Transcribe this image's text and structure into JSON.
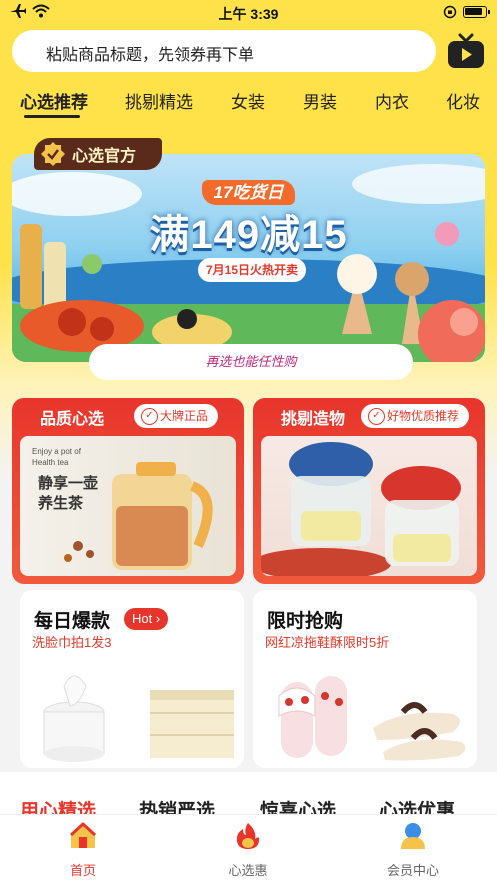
{
  "status_bar": {
    "time": "上午 3:39"
  },
  "search": {
    "placeholder": "粘贴商品标题，先领券再下单"
  },
  "categories": [
    "心选推荐",
    "挑剔精选",
    "女装",
    "男装",
    "内衣",
    "化妆"
  ],
  "banner": {
    "official_label": "心选官方",
    "event_title": "17吃货日",
    "headline": "满149减15",
    "date_line": "7月15日火热开卖",
    "slogan": "再选也能任性购"
  },
  "feature_cards": [
    {
      "title": "品质心选",
      "tag": "大牌正品",
      "image_text_en": "Enjoy a pot of Health tea",
      "image_text_cn_1": "静享一壶",
      "image_text_cn_2": "养生茶"
    },
    {
      "title": "挑剔造物",
      "tag": "好物优质推荐"
    }
  ],
  "product_cards": [
    {
      "title": "每日爆款",
      "badge": "Hot",
      "subtitle": "洗脸巾拍1发3"
    },
    {
      "title": "限时抢购",
      "subtitle": "网红凉拖鞋酥限时5折"
    }
  ],
  "section_tabs": [
    "用心精选",
    "热销严选",
    "惊喜心选",
    "心选优惠"
  ],
  "bottom_nav": [
    {
      "label": "首页",
      "icon": "home-icon"
    },
    {
      "label": "心选惠",
      "icon": "flame-icon"
    },
    {
      "label": "会员中心",
      "icon": "member-icon"
    }
  ],
  "colors": {
    "brand_yellow": "#ffe24a",
    "accent_red": "#e8352c"
  }
}
